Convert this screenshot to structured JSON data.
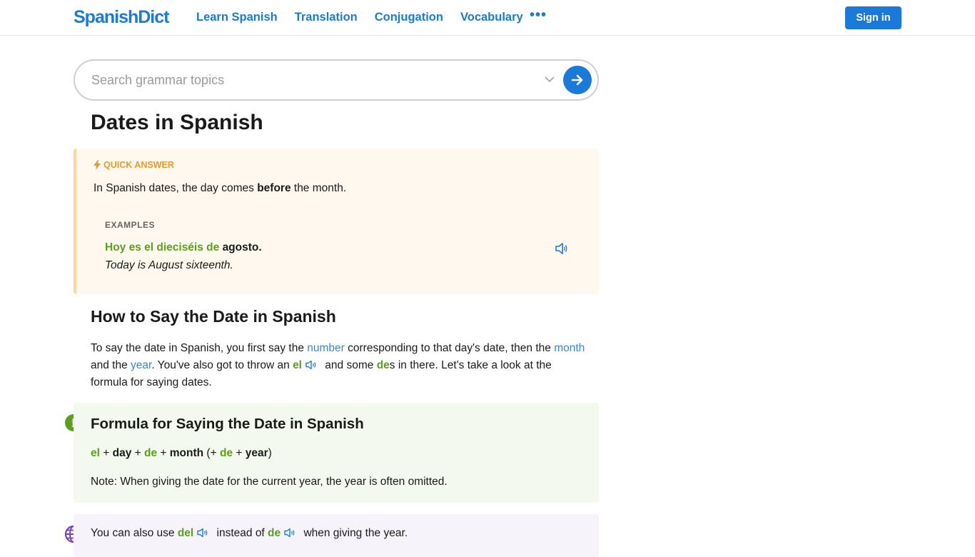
{
  "header": {
    "logo": "SpanishDict",
    "nav": [
      "Learn Spanish",
      "Translation",
      "Conjugation",
      "Vocabulary"
    ],
    "more": "•••",
    "sign_in": "Sign in"
  },
  "search": {
    "placeholder": "Search grammar topics",
    "value": ""
  },
  "page": {
    "title": "Dates in Spanish"
  },
  "quick_answer": {
    "label": "QUICK ANSWER",
    "text_before": "In Spanish dates, the day comes ",
    "text_bold": "before",
    "text_after": " the month.",
    "examples_label": "EXAMPLES",
    "example_es_green": "Hoy es el dieciséis de ",
    "example_es_black": "agosto.",
    "example_en": "Today is August sixteenth."
  },
  "section": {
    "heading": "How to Say the Date in Spanish",
    "p1": "To say the date in Spanish, you first say the ",
    "link_number": "number",
    "p2": " corresponding to that day's date, then the ",
    "link_month": "month",
    "p3": " and the ",
    "link_year": "year",
    "p4": ". You've also got to throw an ",
    "word_el": "el",
    "p5": " and some ",
    "word_de": "de",
    "p6": "s in there. Let's take a look at the formula for saying dates."
  },
  "formula": {
    "title": "Formula for Saying the Date in Spanish",
    "el": "el",
    "plus1": " + ",
    "day": "day",
    "plus2": " + ",
    "de1": "de",
    "plus3": " + ",
    "month": "month",
    "open": " (+ ",
    "de2": "de",
    "plus4": " + ",
    "year": "year",
    "close": ")",
    "note": "Note: When giving the date for the current year, the year is often omitted."
  },
  "tip": {
    "t1": "You can also use ",
    "del": "del",
    "t2": " instead of ",
    "de": "de",
    "t3": " when giving the year."
  }
}
